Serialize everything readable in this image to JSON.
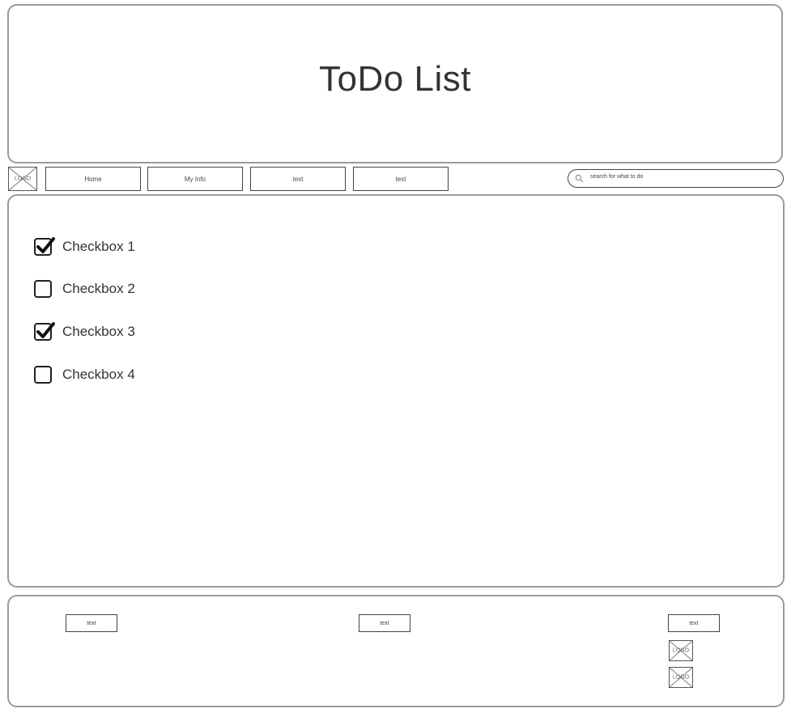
{
  "header": {
    "title": "ToDo List"
  },
  "nav": {
    "logo_text": "LOGO",
    "items": [
      {
        "label": "Home"
      },
      {
        "label": "My Info"
      },
      {
        "label": "text"
      },
      {
        "label": "text"
      }
    ],
    "search": {
      "placeholder": "search for what to do",
      "icon": "search-icon"
    }
  },
  "main": {
    "checkboxes": [
      {
        "label": "Checkbox 1",
        "checked": true
      },
      {
        "label": "Checkbox 2",
        "checked": false
      },
      {
        "label": "Checkbox 3",
        "checked": true
      },
      {
        "label": "Checkbox 4",
        "checked": false
      }
    ]
  },
  "footer": {
    "items": [
      {
        "label": "text"
      },
      {
        "label": "text"
      },
      {
        "label": "text"
      }
    ],
    "logos": [
      {
        "text": "LOGO"
      },
      {
        "text": "LOGO"
      }
    ]
  },
  "colors": {
    "panel_border": "#9a9a9a",
    "control_border": "#444444",
    "text": "#333333"
  }
}
